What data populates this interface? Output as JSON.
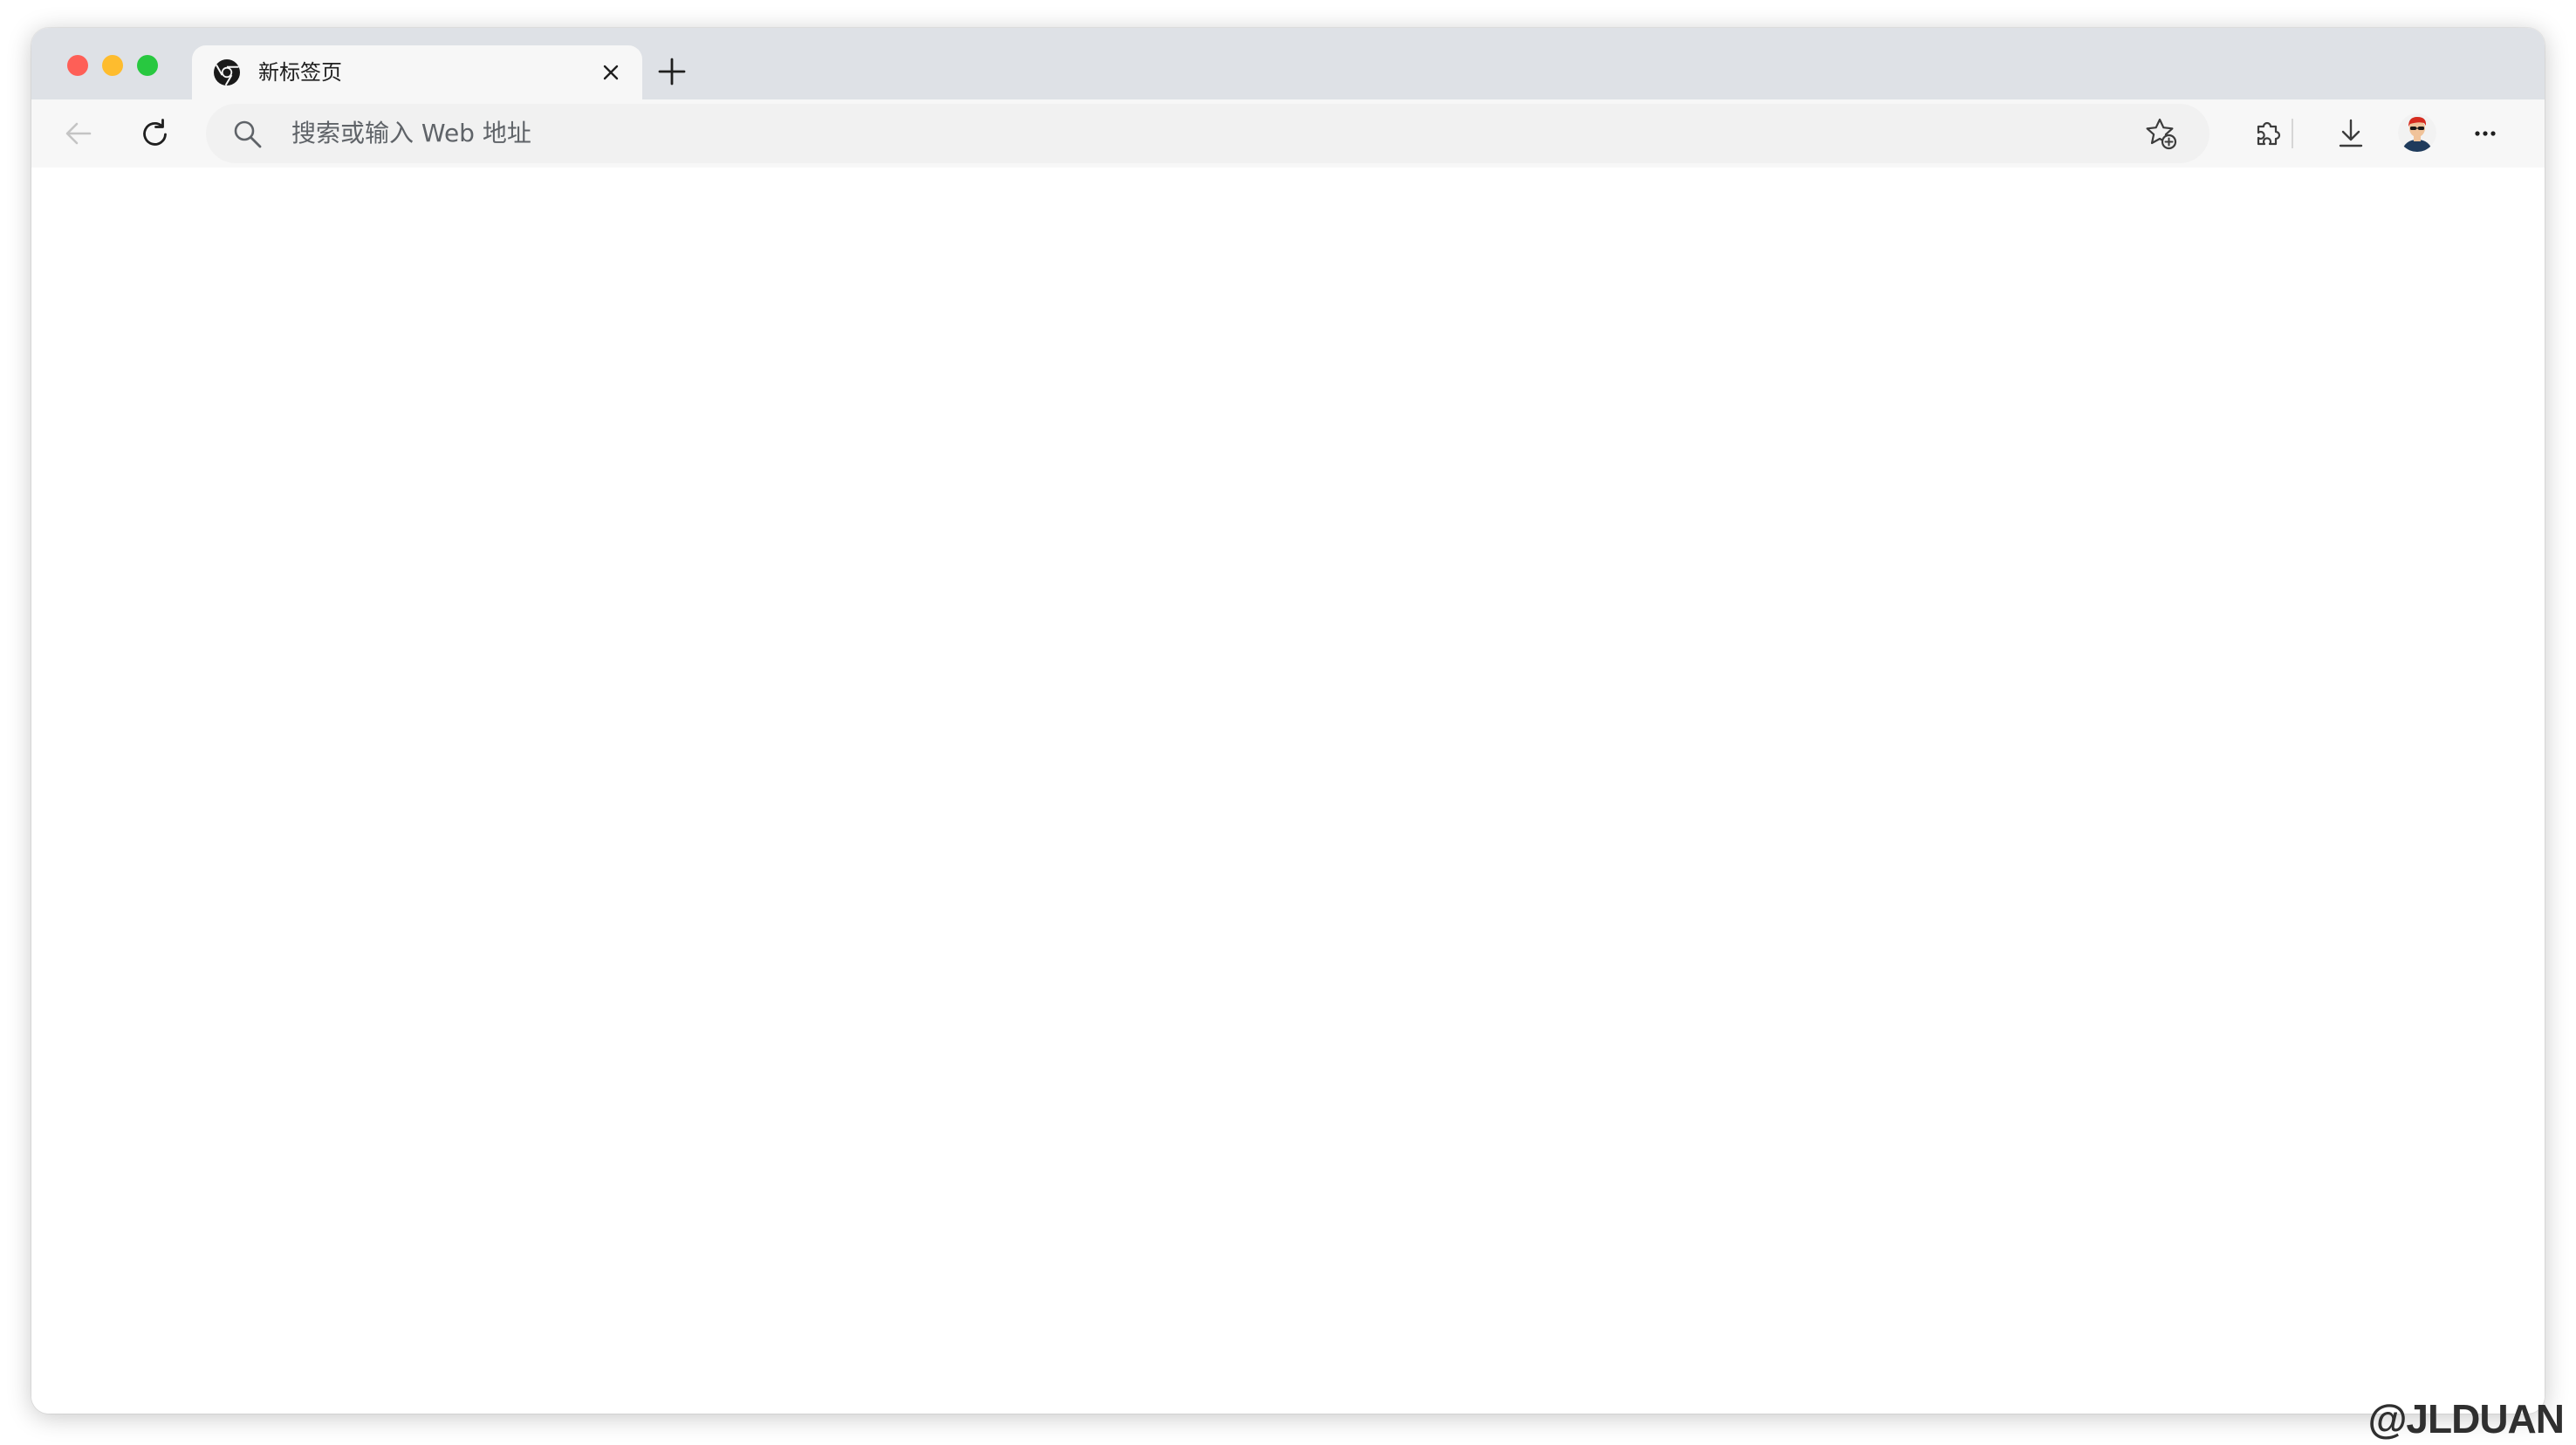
{
  "browser": {
    "tab": {
      "title": "新标签页",
      "favicon": "chrome-logo-icon"
    },
    "new_tab_icon": "plus-icon",
    "toolbar": {
      "back_icon": "back-arrow-icon",
      "reload_icon": "reload-icon",
      "address_bar": {
        "placeholder": "搜索或输入 Web 地址",
        "value": "",
        "search_icon": "search-icon",
        "favorite_icon": "star-add-icon"
      },
      "extensions_icon": "puzzle-icon",
      "downloads_icon": "download-icon",
      "profile_icon": "avatar",
      "menu_icon": "more-horizontal-icon"
    },
    "window_controls": [
      "close",
      "minimize",
      "maximize"
    ]
  },
  "colors": {
    "tab_strip": "#dee1e6",
    "toolbar": "#f7f7f7",
    "close": "#fe5f57",
    "minimize": "#febc2e",
    "maximize": "#28c840"
  },
  "watermark": "@JLDUAN"
}
